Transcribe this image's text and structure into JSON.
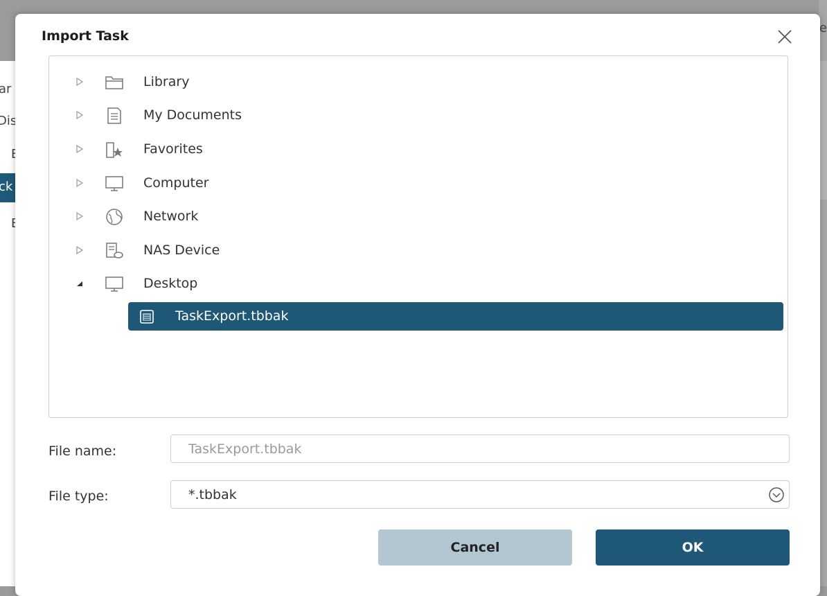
{
  "background": {
    "items": [
      "ar",
      "Dis",
      "E",
      "ck",
      "E"
    ],
    "right_fragment": "e"
  },
  "dialog": {
    "title": "Import Task",
    "tree": [
      {
        "label": "Library",
        "icon": "folder-icon",
        "expanded": false
      },
      {
        "label": "My Documents",
        "icon": "document-icon",
        "expanded": false
      },
      {
        "label": "Favorites",
        "icon": "favorites-icon",
        "expanded": false
      },
      {
        "label": "Computer",
        "icon": "monitor-icon",
        "expanded": false
      },
      {
        "label": "Network",
        "icon": "globe-icon",
        "expanded": false
      },
      {
        "label": "NAS Device",
        "icon": "nas-icon",
        "expanded": false
      },
      {
        "label": "Desktop",
        "icon": "monitor-icon",
        "expanded": true
      }
    ],
    "selected_file": "TaskExport.tbbak",
    "file_name_label": "File name:",
    "file_name_value": "TaskExport.tbbak",
    "file_type_label": "File type:",
    "file_type_value": "*.tbbak",
    "cancel_label": "Cancel",
    "ok_label": "OK"
  },
  "colors": {
    "accent": "#1e5876",
    "cancel_bg": "#b3c7d2"
  }
}
